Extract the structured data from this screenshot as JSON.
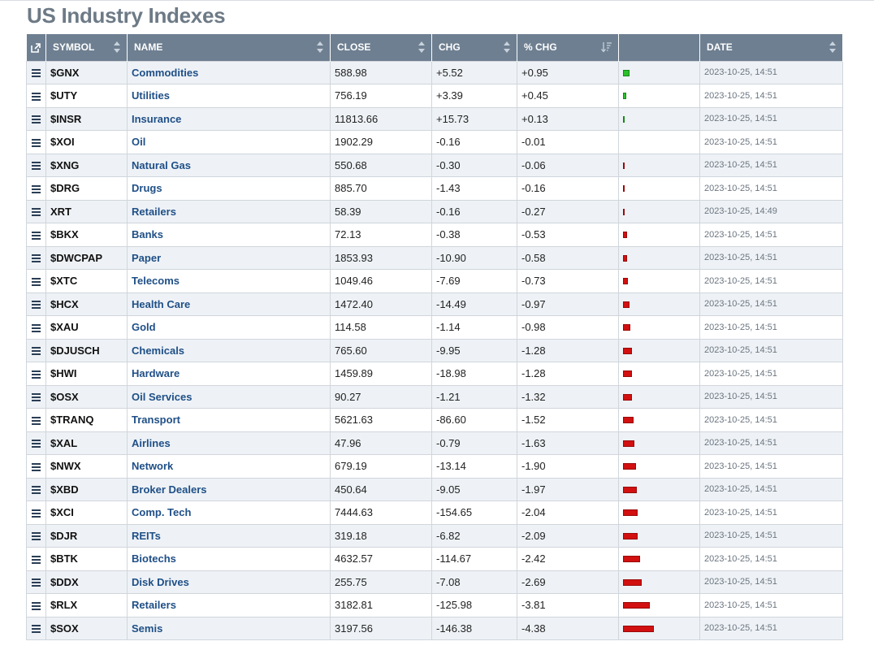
{
  "page": {
    "title": "US Industry Indexes"
  },
  "table": {
    "headers": {
      "symbol": "SYMBOL",
      "name": "NAME",
      "close": "CLOSE",
      "chg": "CHG",
      "pct_chg": "% CHG",
      "bar": "",
      "date": "DATE"
    },
    "sort": {
      "column": "% CHG",
      "direction": "descending"
    },
    "colors": {
      "header_bg": "#6e7f91",
      "positive": "#2bbf2b",
      "negative": "#d21010",
      "link": "#1f4f87"
    },
    "rows": [
      {
        "symbol": "$GNX",
        "name": "Commodities",
        "close": "588.98",
        "chg": "+5.52",
        "pct": "+0.95",
        "pct_value": 0.95,
        "date": "2023-10-25, 14:51"
      },
      {
        "symbol": "$UTY",
        "name": "Utilities",
        "close": "756.19",
        "chg": "+3.39",
        "pct": "+0.45",
        "pct_value": 0.45,
        "date": "2023-10-25, 14:51"
      },
      {
        "symbol": "$INSR",
        "name": "Insurance",
        "close": "11813.66",
        "chg": "+15.73",
        "pct": "+0.13",
        "pct_value": 0.13,
        "date": "2023-10-25, 14:51"
      },
      {
        "symbol": "$XOI",
        "name": "Oil",
        "close": "1902.29",
        "chg": "-0.16",
        "pct": "-0.01",
        "pct_value": -0.01,
        "date": "2023-10-25, 14:51"
      },
      {
        "symbol": "$XNG",
        "name": "Natural Gas",
        "close": "550.68",
        "chg": "-0.30",
        "pct": "-0.06",
        "pct_value": -0.06,
        "date": "2023-10-25, 14:51"
      },
      {
        "symbol": "$DRG",
        "name": "Drugs",
        "close": "885.70",
        "chg": "-1.43",
        "pct": "-0.16",
        "pct_value": -0.16,
        "date": "2023-10-25, 14:51"
      },
      {
        "symbol": "XRT",
        "name": "Retailers",
        "close": "58.39",
        "chg": "-0.16",
        "pct": "-0.27",
        "pct_value": -0.27,
        "date": "2023-10-25, 14:49"
      },
      {
        "symbol": "$BKX",
        "name": "Banks",
        "close": "72.13",
        "chg": "-0.38",
        "pct": "-0.53",
        "pct_value": -0.53,
        "date": "2023-10-25, 14:51"
      },
      {
        "symbol": "$DWCPAP",
        "name": "Paper",
        "close": "1853.93",
        "chg": "-10.90",
        "pct": "-0.58",
        "pct_value": -0.58,
        "date": "2023-10-25, 14:51"
      },
      {
        "symbol": "$XTC",
        "name": "Telecoms",
        "close": "1049.46",
        "chg": "-7.69",
        "pct": "-0.73",
        "pct_value": -0.73,
        "date": "2023-10-25, 14:51"
      },
      {
        "symbol": "$HCX",
        "name": "Health Care",
        "close": "1472.40",
        "chg": "-14.49",
        "pct": "-0.97",
        "pct_value": -0.97,
        "date": "2023-10-25, 14:51"
      },
      {
        "symbol": "$XAU",
        "name": "Gold",
        "close": "114.58",
        "chg": "-1.14",
        "pct": "-0.98",
        "pct_value": -0.98,
        "date": "2023-10-25, 14:51"
      },
      {
        "symbol": "$DJUSCH",
        "name": "Chemicals",
        "close": "765.60",
        "chg": "-9.95",
        "pct": "-1.28",
        "pct_value": -1.28,
        "date": "2023-10-25, 14:51"
      },
      {
        "symbol": "$HWI",
        "name": "Hardware",
        "close": "1459.89",
        "chg": "-18.98",
        "pct": "-1.28",
        "pct_value": -1.28,
        "date": "2023-10-25, 14:51"
      },
      {
        "symbol": "$OSX",
        "name": "Oil Services",
        "close": "90.27",
        "chg": "-1.21",
        "pct": "-1.32",
        "pct_value": -1.32,
        "date": "2023-10-25, 14:51"
      },
      {
        "symbol": "$TRANQ",
        "name": "Transport",
        "close": "5621.63",
        "chg": "-86.60",
        "pct": "-1.52",
        "pct_value": -1.52,
        "date": "2023-10-25, 14:51"
      },
      {
        "symbol": "$XAL",
        "name": "Airlines",
        "close": "47.96",
        "chg": "-0.79",
        "pct": "-1.63",
        "pct_value": -1.63,
        "date": "2023-10-25, 14:51"
      },
      {
        "symbol": "$NWX",
        "name": "Network",
        "close": "679.19",
        "chg": "-13.14",
        "pct": "-1.90",
        "pct_value": -1.9,
        "date": "2023-10-25, 14:51"
      },
      {
        "symbol": "$XBD",
        "name": "Broker Dealers",
        "close": "450.64",
        "chg": "-9.05",
        "pct": "-1.97",
        "pct_value": -1.97,
        "date": "2023-10-25, 14:51"
      },
      {
        "symbol": "$XCI",
        "name": "Comp. Tech",
        "close": "7444.63",
        "chg": "-154.65",
        "pct": "-2.04",
        "pct_value": -2.04,
        "date": "2023-10-25, 14:51"
      },
      {
        "symbol": "$DJR",
        "name": "REITs",
        "close": "319.18",
        "chg": "-6.82",
        "pct": "-2.09",
        "pct_value": -2.09,
        "date": "2023-10-25, 14:51"
      },
      {
        "symbol": "$BTK",
        "name": "Biotechs",
        "close": "4632.57",
        "chg": "-114.67",
        "pct": "-2.42",
        "pct_value": -2.42,
        "date": "2023-10-25, 14:51"
      },
      {
        "symbol": "$DDX",
        "name": "Disk Drives",
        "close": "255.75",
        "chg": "-7.08",
        "pct": "-2.69",
        "pct_value": -2.69,
        "date": "2023-10-25, 14:51"
      },
      {
        "symbol": "$RLX",
        "name": "Retailers",
        "close": "3182.81",
        "chg": "-125.98",
        "pct": "-3.81",
        "pct_value": -3.81,
        "date": "2023-10-25, 14:51"
      },
      {
        "symbol": "$SOX",
        "name": "Semis",
        "close": "3197.56",
        "chg": "-146.38",
        "pct": "-4.38",
        "pct_value": -4.38,
        "date": "2023-10-25, 14:51"
      }
    ]
  }
}
